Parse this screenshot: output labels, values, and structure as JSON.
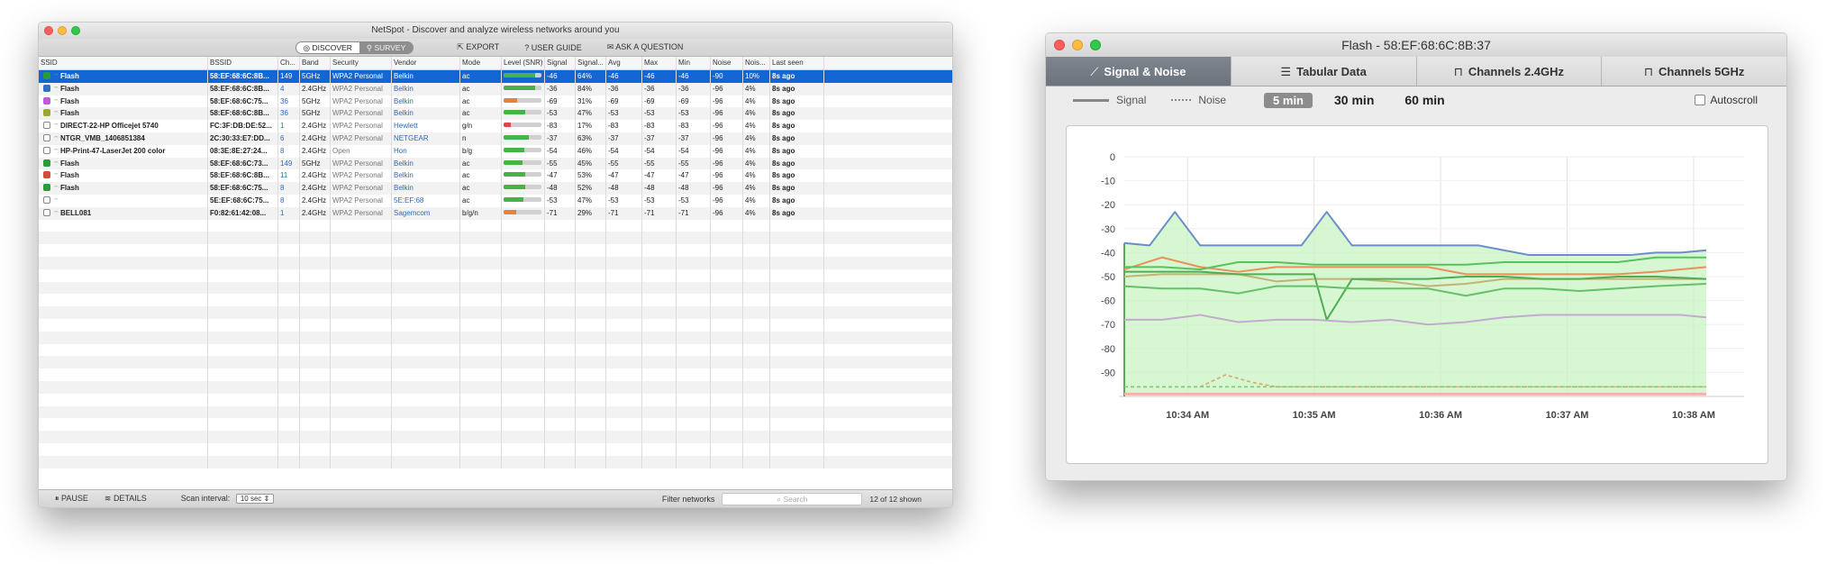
{
  "main_window": {
    "title": "NetSpot - Discover and analyze wireless networks around you",
    "mode_discover": "DISCOVER",
    "mode_survey": "SURVEY",
    "export": "EXPORT",
    "user_guide": "USER GUIDE",
    "ask_question": "ASK A QUESTION",
    "columns": [
      "SSID",
      "BSSID",
      "Ch...",
      "Band",
      "Security",
      "Vendor",
      "Mode",
      "Level (SNR)",
      "Signal",
      "Signal...",
      "Avg",
      "Max",
      "Min",
      "Noise",
      "Nois...",
      "Last seen"
    ],
    "rows": [
      {
        "checked": true,
        "color": "#2a9a3a",
        "ssid": "Flash",
        "bssid": "58:EF:68:6C:8B...",
        "ch": "149",
        "band": "5GHz",
        "security": "WPA2 Personal",
        "vendor": "Belkin",
        "mode": "ac",
        "level": 0.84,
        "level_color": "#47b247",
        "signal": "-46",
        "signal_pct": "64%",
        "avg": "-46",
        "max": "-46",
        "min": "-46",
        "noise": "-90",
        "noise_pct": "10%",
        "last": "8s ago",
        "selected": true
      },
      {
        "checked": true,
        "color": "#2f6fc0",
        "ssid": "Flash",
        "bssid": "58:EF:68:6C:8B...",
        "ch": "4",
        "band": "2.4GHz",
        "security": "WPA2 Personal",
        "vendor": "Belkin",
        "mode": "ac",
        "level": 0.84,
        "level_color": "#47b247",
        "signal": "-36",
        "signal_pct": "84%",
        "avg": "-36",
        "max": "-36",
        "min": "-36",
        "noise": "-96",
        "noise_pct": "4%",
        "last": "8s ago",
        "selected": false
      },
      {
        "checked": true,
        "color": "#c05bd8",
        "ssid": "Flash",
        "bssid": "58:EF:68:6C:75...",
        "ch": "36",
        "band": "5GHz",
        "security": "WPA2 Personal",
        "vendor": "Belkin",
        "mode": "ac",
        "level": 0.36,
        "level_color": "#e8823a",
        "signal": "-69",
        "signal_pct": "31%",
        "avg": "-69",
        "max": "-69",
        "min": "-69",
        "noise": "-96",
        "noise_pct": "4%",
        "last": "8s ago",
        "selected": false
      },
      {
        "checked": true,
        "color": "#9aa832",
        "ssid": "Flash",
        "bssid": "58:EF:68:6C:8B...",
        "ch": "36",
        "band": "5GHz",
        "security": "WPA2 Personal",
        "vendor": "Belkin",
        "mode": "ac",
        "level": 0.56,
        "level_color": "#47b247",
        "signal": "-53",
        "signal_pct": "47%",
        "avg": "-53",
        "max": "-53",
        "min": "-53",
        "noise": "-96",
        "noise_pct": "4%",
        "last": "8s ago",
        "selected": false
      },
      {
        "checked": false,
        "color": "#888888",
        "ssid": "DIRECT-22-HP Officejet 5740",
        "bssid": "FC:3F:DB:DE:52...",
        "ch": "1",
        "band": "2.4GHz",
        "security": "WPA2 Personal",
        "vendor": "Hewlett",
        "mode": "g/n",
        "level": 0.2,
        "level_color": "#e04545",
        "signal": "-83",
        "signal_pct": "17%",
        "avg": "-83",
        "max": "-83",
        "min": "-83",
        "noise": "-96",
        "noise_pct": "4%",
        "last": "8s ago",
        "selected": false
      },
      {
        "checked": false,
        "color": "#888888",
        "ssid": "NTGR_VMB_1406851384",
        "bssid": "2C:30:33:E7:DD...",
        "ch": "6",
        "band": "2.4GHz",
        "security": "WPA2 Personal",
        "vendor": "NETGEAR",
        "mode": "n",
        "level": 0.66,
        "level_color": "#47b247",
        "signal": "-37",
        "signal_pct": "63%",
        "avg": "-37",
        "max": "-37",
        "min": "-37",
        "noise": "-96",
        "noise_pct": "4%",
        "last": "8s ago",
        "selected": false
      },
      {
        "checked": false,
        "color": "#888888",
        "ssid": "HP-Print-47-LaserJet 200 color",
        "bssid": "08:3E:8E:27:24...",
        "ch": "8",
        "band": "2.4GHz",
        "security": "Open",
        "vendor": "Hon",
        "mode": "b/g",
        "level": 0.55,
        "level_color": "#47b247",
        "signal": "-54",
        "signal_pct": "46%",
        "avg": "-54",
        "max": "-54",
        "min": "-54",
        "noise": "-96",
        "noise_pct": "4%",
        "last": "8s ago",
        "selected": false
      },
      {
        "checked": true,
        "color": "#2a9a3a",
        "ssid": "Flash",
        "bssid": "58:EF:68:6C:73...",
        "ch": "149",
        "band": "5GHz",
        "security": "WPA2 Personal",
        "vendor": "Belkin",
        "mode": "ac",
        "level": 0.5,
        "level_color": "#47b247",
        "signal": "-55",
        "signal_pct": "45%",
        "avg": "-55",
        "max": "-55",
        "min": "-55",
        "noise": "-96",
        "noise_pct": "4%",
        "last": "8s ago",
        "selected": false
      },
      {
        "checked": true,
        "color": "#d84b3a",
        "ssid": "Flash",
        "bssid": "58:EF:68:6C:8B...",
        "ch": "11",
        "band": "2.4GHz",
        "security": "WPA2 Personal",
        "vendor": "Belkin",
        "mode": "ac",
        "level": 0.56,
        "level_color": "#47b247",
        "signal": "-47",
        "signal_pct": "53%",
        "avg": "-47",
        "max": "-47",
        "min": "-47",
        "noise": "-96",
        "noise_pct": "4%",
        "last": "8s ago",
        "selected": false
      },
      {
        "checked": true,
        "color": "#2a9a3a",
        "ssid": "Flash",
        "bssid": "58:EF:68:6C:75...",
        "ch": "8",
        "band": "2.4GHz",
        "security": "WPA2 Personal",
        "vendor": "Belkin",
        "mode": "ac",
        "level": 0.56,
        "level_color": "#47b247",
        "signal": "-48",
        "signal_pct": "52%",
        "avg": "-48",
        "max": "-48",
        "min": "-48",
        "noise": "-96",
        "noise_pct": "4%",
        "last": "8s ago",
        "selected": false
      },
      {
        "checked": false,
        "color": "#888888",
        "ssid": "",
        "bssid": "5E:EF:68:6C:75...",
        "ch": "8",
        "band": "2.4GHz",
        "security": "WPA2 Personal",
        "vendor": "5E:EF:68",
        "mode": "ac",
        "level": 0.52,
        "level_color": "#47b247",
        "signal": "-53",
        "signal_pct": "47%",
        "avg": "-53",
        "max": "-53",
        "min": "-53",
        "noise": "-96",
        "noise_pct": "4%",
        "last": "8s ago",
        "selected": false
      },
      {
        "checked": false,
        "color": "#888888",
        "ssid": "BELL081",
        "bssid": "F0:82:61:42:08...",
        "ch": "1",
        "band": "2.4GHz",
        "security": "WPA2 Personal",
        "vendor": "Sagemcom",
        "mode": "b/g/n",
        "level": 0.34,
        "level_color": "#e8823a",
        "signal": "-71",
        "signal_pct": "29%",
        "avg": "-71",
        "max": "-71",
        "min": "-71",
        "noise": "-96",
        "noise_pct": "4%",
        "last": "8s ago",
        "selected": false
      }
    ],
    "pause": "PAUSE",
    "details": "DETAILS",
    "scan_interval_label": "Scan interval:",
    "scan_interval_value": "10 sec",
    "filter_label": "Filter networks",
    "search_placeholder": "Search",
    "shown_count": "12 of 12 shown"
  },
  "chart_window": {
    "title": "Flash - 58:EF:68:6C:8B:37",
    "tabs": [
      {
        "label": "Signal & Noise",
        "icon": "chart-line-icon",
        "active": true
      },
      {
        "label": "Tabular Data",
        "icon": "list-icon",
        "active": false
      },
      {
        "label": "Channels 2.4GHz",
        "icon": "channel-icon",
        "active": false
      },
      {
        "label": "Channels 5GHz",
        "icon": "channel-icon",
        "active": false
      }
    ],
    "legend_signal": "Signal",
    "legend_noise": "Noise",
    "time_buttons": [
      {
        "label": "5 min",
        "active": true
      },
      {
        "label": "30 min",
        "active": false
      },
      {
        "label": "60 min",
        "active": false
      }
    ],
    "autoscroll_label": "Autoscroll"
  },
  "chart_data": {
    "type": "line",
    "title": "",
    "xlabel": "",
    "ylabel": "",
    "ylim": [
      -100,
      0
    ],
    "yticks": [
      0,
      -10,
      -20,
      -30,
      -40,
      -50,
      -60,
      -70,
      -80,
      -90
    ],
    "x_tick_labels": [
      "10:34 AM",
      "10:35 AM",
      "10:36 AM",
      "10:37 AM",
      "10:38 AM"
    ],
    "x_tick_positions": [
      0.5,
      1.5,
      2.5,
      3.5,
      4.5
    ],
    "xlim": [
      0.0,
      4.6
    ],
    "grid": true,
    "series": [
      {
        "color": "#6c8ec8",
        "x": [
          0.0,
          0.2,
          0.4,
          0.6,
          0.8,
          1.0,
          1.2,
          1.4,
          1.6,
          1.8,
          2.0,
          2.2,
          2.4,
          2.6,
          2.8,
          3.0,
          3.2,
          3.4,
          3.6,
          3.8,
          4.0,
          4.2,
          4.4,
          4.6
        ],
        "y": [
          -36,
          -37,
          -23,
          -37,
          -37,
          -37,
          -37,
          -37,
          -23,
          -37,
          -37,
          -37,
          -37,
          -37,
          -37,
          -39,
          -41,
          -41,
          -41,
          -41,
          -41,
          -40,
          -40,
          -39
        ]
      },
      {
        "color": "#e8915a",
        "x": [
          0.0,
          0.3,
          0.6,
          0.9,
          1.2,
          1.5,
          1.8,
          2.1,
          2.4,
          2.7,
          3.0,
          3.3,
          3.6,
          3.9,
          4.2,
          4.6
        ],
        "y": [
          -47,
          -42,
          -46,
          -48,
          -46,
          -46,
          -46,
          -46,
          -46,
          -49,
          -49,
          -49,
          -49,
          -49,
          -48,
          -46
        ]
      },
      {
        "color": "#58c25e",
        "x": [
          0.0,
          0.3,
          0.6,
          0.9,
          1.2,
          1.5,
          1.8,
          2.1,
          2.4,
          2.7,
          3.0,
          3.3,
          3.6,
          3.9,
          4.2,
          4.6
        ],
        "y": [
          -46,
          -46,
          -47,
          -44,
          -44,
          -45,
          -45,
          -45,
          -45,
          -45,
          -44,
          -44,
          -44,
          -44,
          -42,
          -42
        ]
      },
      {
        "color": "#c2b276",
        "x": [
          0.0,
          0.3,
          0.6,
          0.9,
          1.2,
          1.5,
          1.8,
          2.1,
          2.4,
          2.7,
          3.0,
          3.3,
          3.6,
          3.9,
          4.2,
          4.6
        ],
        "y": [
          -50,
          -49,
          -49,
          -49,
          -52,
          -51,
          -51,
          -52,
          -54,
          -53,
          -51,
          -51,
          -51,
          -51,
          -51,
          -51
        ]
      },
      {
        "color": "#4fae52",
        "x": [
          0.0,
          0.3,
          0.6,
          0.9,
          1.2,
          1.5,
          1.6,
          1.8,
          2.1,
          2.4,
          2.7,
          3.0,
          3.3,
          3.6,
          3.9,
          4.2,
          4.6
        ],
        "y": [
          -48,
          -48,
          -48,
          -49,
          -49,
          -49,
          -68,
          -51,
          -51,
          -51,
          -50,
          -50,
          -51,
          -51,
          -50,
          -50,
          -51
        ]
      },
      {
        "color": "#66c069",
        "x": [
          0.0,
          0.3,
          0.6,
          0.9,
          1.2,
          1.5,
          1.8,
          2.1,
          2.4,
          2.7,
          3.0,
          3.3,
          3.6,
          3.9,
          4.2,
          4.6
        ],
        "y": [
          -54,
          -55,
          -55,
          -57,
          -54,
          -54,
          -55,
          -55,
          -55,
          -58,
          -55,
          -55,
          -56,
          -55,
          -54,
          -53
        ]
      },
      {
        "color": "#c5a9cf",
        "x": [
          0.0,
          0.3,
          0.6,
          0.9,
          1.2,
          1.5,
          1.8,
          2.1,
          2.4,
          2.7,
          3.0,
          3.3,
          3.6,
          3.9,
          4.2,
          4.4,
          4.6
        ],
        "y": [
          -68,
          -68,
          -66,
          -69,
          -68,
          -68,
          -69,
          -68,
          -70,
          -69,
          -67,
          -66,
          -66,
          -66,
          -66,
          -66,
          -67
        ]
      },
      {
        "color": "#d9a86a",
        "dashed": true,
        "x": [
          0.0,
          0.6,
          0.8,
          1.0,
          1.2,
          1.6,
          2.4,
          3.6,
          4.6
        ],
        "y": [
          -96,
          -96,
          -91,
          -94,
          -96,
          -96,
          -96,
          -96,
          -96
        ]
      },
      {
        "color": "#7ccc7c",
        "dashed": true,
        "x": [
          0.0,
          4.6
        ],
        "y": [
          -96,
          -96
        ]
      }
    ]
  }
}
